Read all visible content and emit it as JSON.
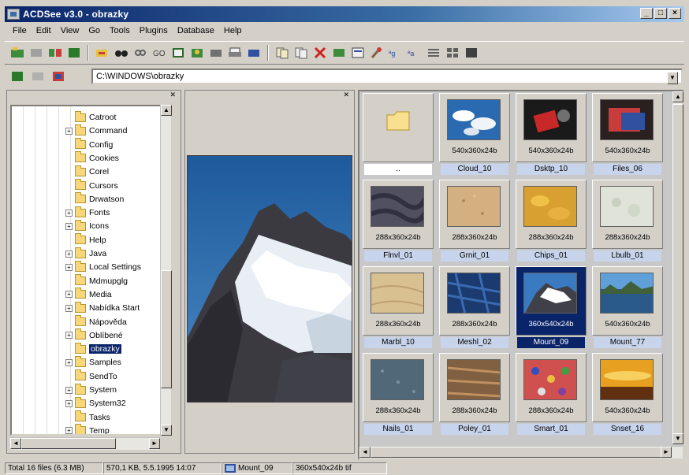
{
  "window": {
    "title": "ACDSee v3.0 - obrazky",
    "buttons": [
      "_",
      "□",
      "×"
    ]
  },
  "menu": [
    "File",
    "Edit",
    "View",
    "Go",
    "Tools",
    "Plugins",
    "Database",
    "Help"
  ],
  "address": {
    "path": "C:\\WINDOWS\\obrazky"
  },
  "tree": {
    "items": [
      {
        "label": "Catroot",
        "expand": ""
      },
      {
        "label": "Command",
        "expand": "+"
      },
      {
        "label": "Config",
        "expand": ""
      },
      {
        "label": "Cookies",
        "expand": ""
      },
      {
        "label": "Corel",
        "expand": ""
      },
      {
        "label": "Cursors",
        "expand": ""
      },
      {
        "label": "Drwatson",
        "expand": ""
      },
      {
        "label": "Fonts",
        "expand": "+"
      },
      {
        "label": "Icons",
        "expand": "+"
      },
      {
        "label": "Help",
        "expand": ""
      },
      {
        "label": "Java",
        "expand": "+"
      },
      {
        "label": "Local Settings",
        "expand": "+"
      },
      {
        "label": "Mdmupglg",
        "expand": ""
      },
      {
        "label": "Media",
        "expand": "+"
      },
      {
        "label": "Nabídka Start",
        "expand": "+"
      },
      {
        "label": "Nápověda",
        "expand": ""
      },
      {
        "label": "Oblíbené",
        "expand": "+"
      },
      {
        "label": "obrazky",
        "expand": "",
        "selected": true
      },
      {
        "label": "Samples",
        "expand": "+"
      },
      {
        "label": "SendTo",
        "expand": ""
      },
      {
        "label": "System",
        "expand": "+"
      },
      {
        "label": "System32",
        "expand": "+"
      },
      {
        "label": "Tasks",
        "expand": ""
      },
      {
        "label": "Temp",
        "expand": "+"
      }
    ]
  },
  "files": [
    {
      "name": "..",
      "dims": "",
      "kind": "folder"
    },
    {
      "name": "Cloud_10",
      "dims": "540x360x24b",
      "kind": "cloud"
    },
    {
      "name": "Dsktp_10",
      "dims": "540x360x24b",
      "kind": "desk"
    },
    {
      "name": "Files_06",
      "dims": "540x360x24b",
      "kind": "files"
    },
    {
      "name": "Flnvl_01",
      "dims": "288x360x24b",
      "kind": "fabric"
    },
    {
      "name": "Grnit_01",
      "dims": "288x360x24b",
      "kind": "sand"
    },
    {
      "name": "Chips_01",
      "dims": "288x360x24b",
      "kind": "chips"
    },
    {
      "name": "Lbulb_01",
      "dims": "288x360x24b",
      "kind": "bulb"
    },
    {
      "name": "Marbl_10",
      "dims": "288x360x24b",
      "kind": "marble"
    },
    {
      "name": "Meshl_02",
      "dims": "288x360x24b",
      "kind": "mesh"
    },
    {
      "name": "Mount_09",
      "dims": "360x540x24b",
      "kind": "mountain",
      "selected": true
    },
    {
      "name": "Mount_77",
      "dims": "540x360x24b",
      "kind": "lake"
    },
    {
      "name": "Nails_01",
      "dims": "288x360x24b",
      "kind": "nails"
    },
    {
      "name": "Poley_01",
      "dims": "288x360x24b",
      "kind": "poley"
    },
    {
      "name": "Smart_01",
      "dims": "288x360x24b",
      "kind": "smart"
    },
    {
      "name": "Snset_16",
      "dims": "540x360x24b",
      "kind": "sunset"
    }
  ],
  "status": {
    "total": "Total 16 files (6.3 MB)",
    "fileinfo": "570,1 KB, 5.5.1995 14:07",
    "name": "Mount_09",
    "dims": "360x540x24b tif"
  },
  "colors": {
    "titlebar": "#0a246a",
    "selection": "#0a246a",
    "chrome": "#d4d0c8"
  }
}
